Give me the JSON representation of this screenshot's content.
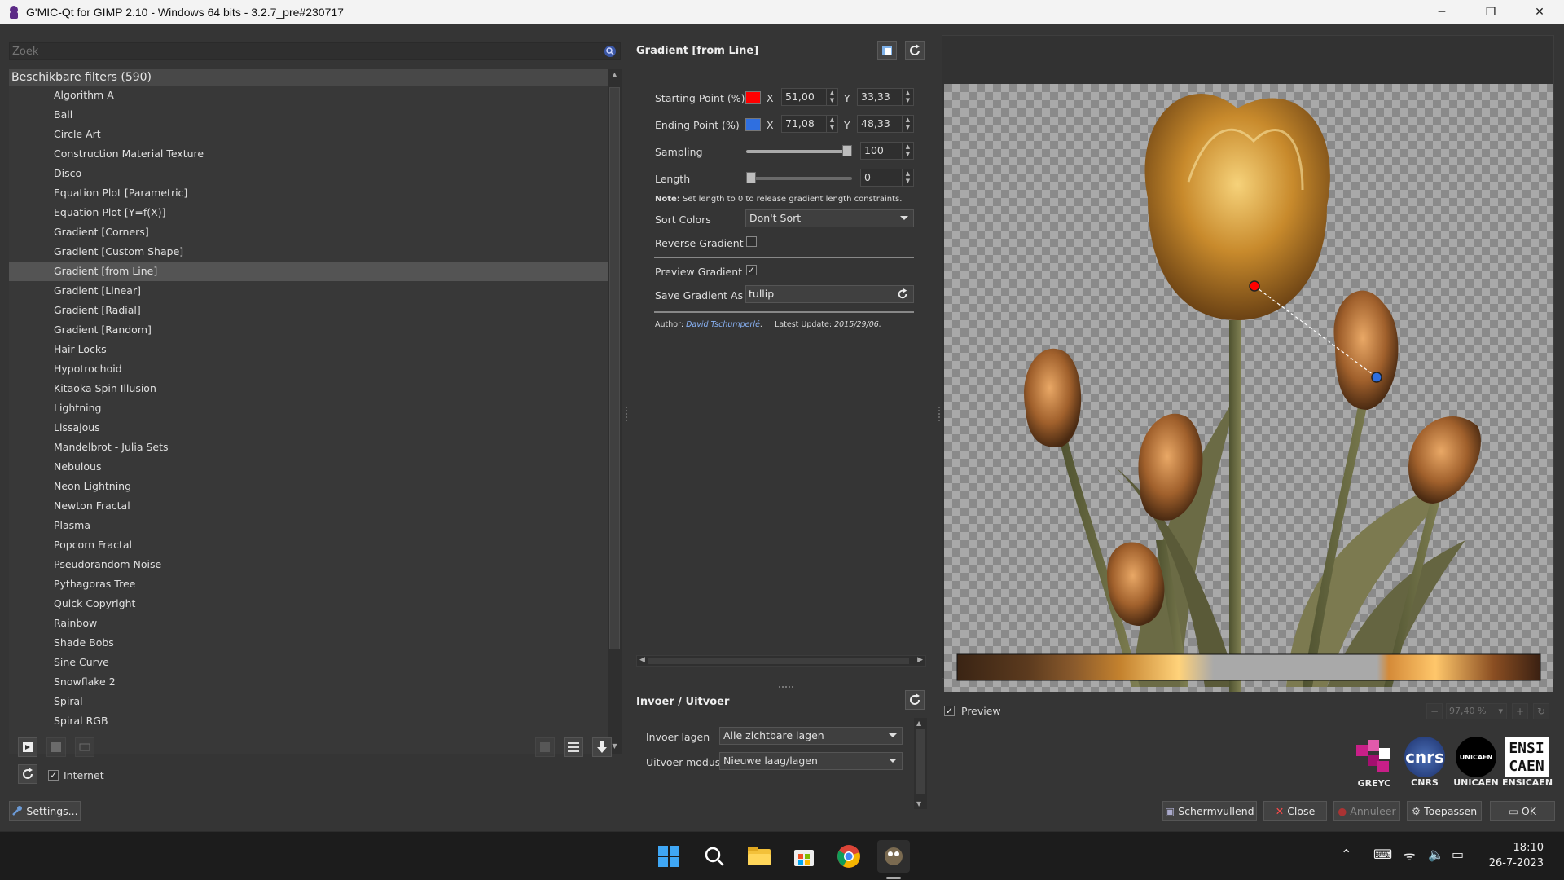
{
  "window": {
    "title": "G'MIC-Qt for GIMP 2.10 - Windows 64 bits - 3.2.7_pre#230717",
    "minimize": "─",
    "maximize": "❐",
    "close": "✕"
  },
  "filters": {
    "search_placeholder": "Zoek",
    "header": "Beschikbare filters (590)",
    "items": [
      "Algorithm A",
      "Ball",
      "Circle Art",
      "Construction Material Texture",
      "Disco",
      "Equation Plot [Parametric]",
      "Equation Plot [Y=f(X)]",
      "Gradient [Corners]",
      "Gradient [Custom Shape]",
      "Gradient [from Line]",
      "Gradient [Linear]",
      "Gradient [Radial]",
      "Gradient [Random]",
      "Hair Locks",
      "Hypotrochoid",
      "Kitaoka Spin Illusion",
      "Lightning",
      "Lissajous",
      "Mandelbrot - Julia Sets",
      "Nebulous",
      "Neon Lightning",
      "Newton Fractal",
      "Plasma",
      "Popcorn Fractal",
      "Pseudorandom Noise",
      "Pythagoras Tree",
      "Quick Copyright",
      "Rainbow",
      "Shade Bobs",
      "Sine Curve",
      "Snowflake 2",
      "Spiral",
      "Spiral RGB"
    ],
    "selected_index": 9,
    "internet_label": "Internet",
    "settings_label": "Settings..."
  },
  "filter_panel": {
    "title": "Gradient [from Line]",
    "starting_point": {
      "label": "Starting Point (%)",
      "color": "#ff0000",
      "x_label": "X",
      "x": "51,00",
      "y_label": "Y",
      "y": "33,33"
    },
    "ending_point": {
      "label": "Ending Point (%)",
      "color": "#2f6fe0",
      "x_label": "X",
      "x": "71,08",
      "y_label": "Y",
      "y": "48,33"
    },
    "sampling": {
      "label": "Sampling",
      "value": "100",
      "level": 1.0
    },
    "length": {
      "label": "Length",
      "value": "0",
      "level": 0.0
    },
    "note_bold": "Note:",
    "note": " Set length to 0 to release gradient length constraints.",
    "sort_colors": {
      "label": "Sort Colors",
      "value": "Don't Sort"
    },
    "reverse_gradient": {
      "label": "Reverse Gradient",
      "checked": false
    },
    "preview_gradient": {
      "label": "Preview Gradient",
      "checked": true
    },
    "save_gradient": {
      "label": "Save Gradient As",
      "value": "tullip"
    },
    "author_label": "Author:",
    "author": "David Tschumperlé",
    "update_label": "Latest Update:",
    "update": "2015/29/06."
  },
  "io": {
    "title": "Invoer / Uitvoer",
    "input_label": "Invoer lagen",
    "input_value": "Alle zichtbare lagen",
    "output_label": "Uitvoer-modus",
    "output_value": "Nieuwe laag/lagen"
  },
  "preview": {
    "label": "Preview",
    "zoom": "97,40 %"
  },
  "logos": [
    {
      "name": "GREYC",
      "caption": "GREYC"
    },
    {
      "name": "CNRS",
      "caption": "CNRS",
      "mark": "cnrs"
    },
    {
      "name": "UNICAEN",
      "caption": "UNICAEN",
      "mark": "UNICAEN"
    },
    {
      "name": "ENSICAEN",
      "caption": "ENSICAEN",
      "mark": "ENSI CAEN"
    }
  ],
  "buttons": {
    "fullscreen": "Schermvullend",
    "close": "Close",
    "cancel": "Annuleer",
    "apply": "Toepassen",
    "ok": "OK"
  },
  "taskbar": {
    "time": "18:10",
    "date": "26-7-2023"
  }
}
